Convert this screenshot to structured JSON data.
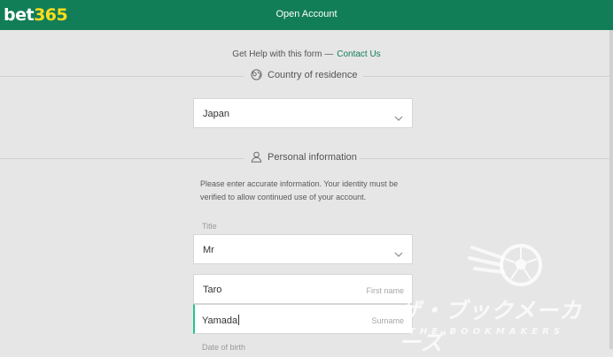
{
  "header": {
    "logo_part1": "bet",
    "logo_part2": "365",
    "title": "Open Account"
  },
  "help": {
    "text": "Get Help with this form —",
    "link": "Contact Us"
  },
  "country_section": {
    "icon": "globe-icon",
    "label": "Country of residence",
    "value": "Japan"
  },
  "personal_section": {
    "icon": "user-icon",
    "label": "Personal information",
    "info": "Please enter accurate information. Your identity must be verified to allow continued use of your account.",
    "title_label": "Title",
    "title_value": "Mr",
    "first_name_value": "Taro",
    "first_name_placeholder": "First name",
    "surname_value": "Yamada",
    "surname_placeholder": "Surname",
    "dob_label": "Date of birth"
  },
  "watermark": {
    "text": "ザ・ブックメーカーズ",
    "subtext": "THE BOOKMAKERS"
  },
  "colors": {
    "brand_green": "#127e58",
    "logo_yellow": "#ffdf1b",
    "active_accent": "#26c48c",
    "background": "#e6e6e6"
  }
}
